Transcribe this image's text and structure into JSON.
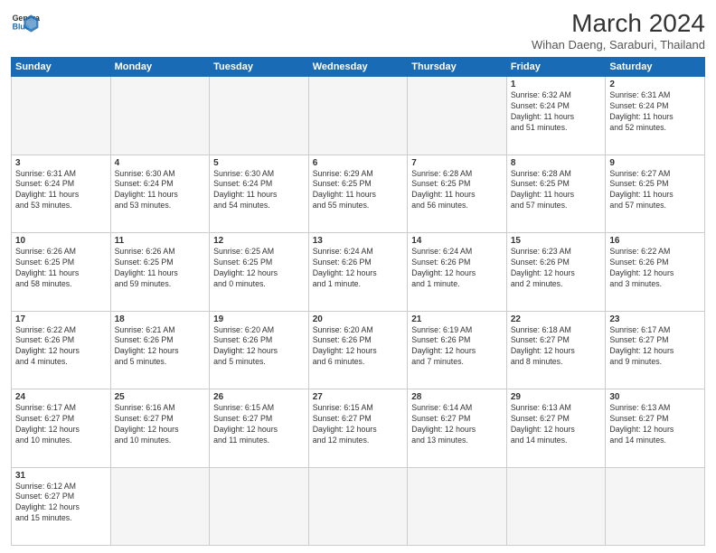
{
  "header": {
    "logo_line1": "General",
    "logo_line2": "Blue",
    "month_year": "March 2024",
    "location": "Wihan Daeng, Saraburi, Thailand"
  },
  "weekdays": [
    "Sunday",
    "Monday",
    "Tuesday",
    "Wednesday",
    "Thursday",
    "Friday",
    "Saturday"
  ],
  "weeks": [
    [
      {
        "date": "",
        "info": ""
      },
      {
        "date": "",
        "info": ""
      },
      {
        "date": "",
        "info": ""
      },
      {
        "date": "",
        "info": ""
      },
      {
        "date": "",
        "info": ""
      },
      {
        "date": "1",
        "info": "Sunrise: 6:32 AM\nSunset: 6:24 PM\nDaylight: 11 hours\nand 51 minutes."
      },
      {
        "date": "2",
        "info": "Sunrise: 6:31 AM\nSunset: 6:24 PM\nDaylight: 11 hours\nand 52 minutes."
      }
    ],
    [
      {
        "date": "3",
        "info": "Sunrise: 6:31 AM\nSunset: 6:24 PM\nDaylight: 11 hours\nand 53 minutes."
      },
      {
        "date": "4",
        "info": "Sunrise: 6:30 AM\nSunset: 6:24 PM\nDaylight: 11 hours\nand 53 minutes."
      },
      {
        "date": "5",
        "info": "Sunrise: 6:30 AM\nSunset: 6:24 PM\nDaylight: 11 hours\nand 54 minutes."
      },
      {
        "date": "6",
        "info": "Sunrise: 6:29 AM\nSunset: 6:25 PM\nDaylight: 11 hours\nand 55 minutes."
      },
      {
        "date": "7",
        "info": "Sunrise: 6:28 AM\nSunset: 6:25 PM\nDaylight: 11 hours\nand 56 minutes."
      },
      {
        "date": "8",
        "info": "Sunrise: 6:28 AM\nSunset: 6:25 PM\nDaylight: 11 hours\nand 57 minutes."
      },
      {
        "date": "9",
        "info": "Sunrise: 6:27 AM\nSunset: 6:25 PM\nDaylight: 11 hours\nand 57 minutes."
      }
    ],
    [
      {
        "date": "10",
        "info": "Sunrise: 6:26 AM\nSunset: 6:25 PM\nDaylight: 11 hours\nand 58 minutes."
      },
      {
        "date": "11",
        "info": "Sunrise: 6:26 AM\nSunset: 6:25 PM\nDaylight: 11 hours\nand 59 minutes."
      },
      {
        "date": "12",
        "info": "Sunrise: 6:25 AM\nSunset: 6:25 PM\nDaylight: 12 hours\nand 0 minutes."
      },
      {
        "date": "13",
        "info": "Sunrise: 6:24 AM\nSunset: 6:26 PM\nDaylight: 12 hours\nand 1 minute."
      },
      {
        "date": "14",
        "info": "Sunrise: 6:24 AM\nSunset: 6:26 PM\nDaylight: 12 hours\nand 1 minute."
      },
      {
        "date": "15",
        "info": "Sunrise: 6:23 AM\nSunset: 6:26 PM\nDaylight: 12 hours\nand 2 minutes."
      },
      {
        "date": "16",
        "info": "Sunrise: 6:22 AM\nSunset: 6:26 PM\nDaylight: 12 hours\nand 3 minutes."
      }
    ],
    [
      {
        "date": "17",
        "info": "Sunrise: 6:22 AM\nSunset: 6:26 PM\nDaylight: 12 hours\nand 4 minutes."
      },
      {
        "date": "18",
        "info": "Sunrise: 6:21 AM\nSunset: 6:26 PM\nDaylight: 12 hours\nand 5 minutes."
      },
      {
        "date": "19",
        "info": "Sunrise: 6:20 AM\nSunset: 6:26 PM\nDaylight: 12 hours\nand 5 minutes."
      },
      {
        "date": "20",
        "info": "Sunrise: 6:20 AM\nSunset: 6:26 PM\nDaylight: 12 hours\nand 6 minutes."
      },
      {
        "date": "21",
        "info": "Sunrise: 6:19 AM\nSunset: 6:26 PM\nDaylight: 12 hours\nand 7 minutes."
      },
      {
        "date": "22",
        "info": "Sunrise: 6:18 AM\nSunset: 6:27 PM\nDaylight: 12 hours\nand 8 minutes."
      },
      {
        "date": "23",
        "info": "Sunrise: 6:17 AM\nSunset: 6:27 PM\nDaylight: 12 hours\nand 9 minutes."
      }
    ],
    [
      {
        "date": "24",
        "info": "Sunrise: 6:17 AM\nSunset: 6:27 PM\nDaylight: 12 hours\nand 10 minutes."
      },
      {
        "date": "25",
        "info": "Sunrise: 6:16 AM\nSunset: 6:27 PM\nDaylight: 12 hours\nand 10 minutes."
      },
      {
        "date": "26",
        "info": "Sunrise: 6:15 AM\nSunset: 6:27 PM\nDaylight: 12 hours\nand 11 minutes."
      },
      {
        "date": "27",
        "info": "Sunrise: 6:15 AM\nSunset: 6:27 PM\nDaylight: 12 hours\nand 12 minutes."
      },
      {
        "date": "28",
        "info": "Sunrise: 6:14 AM\nSunset: 6:27 PM\nDaylight: 12 hours\nand 13 minutes."
      },
      {
        "date": "29",
        "info": "Sunrise: 6:13 AM\nSunset: 6:27 PM\nDaylight: 12 hours\nand 14 minutes."
      },
      {
        "date": "30",
        "info": "Sunrise: 6:13 AM\nSunset: 6:27 PM\nDaylight: 12 hours\nand 14 minutes."
      }
    ],
    [
      {
        "date": "31",
        "info": "Sunrise: 6:12 AM\nSunset: 6:27 PM\nDaylight: 12 hours\nand 15 minutes."
      },
      {
        "date": "",
        "info": ""
      },
      {
        "date": "",
        "info": ""
      },
      {
        "date": "",
        "info": ""
      },
      {
        "date": "",
        "info": ""
      },
      {
        "date": "",
        "info": ""
      },
      {
        "date": "",
        "info": ""
      }
    ]
  ]
}
